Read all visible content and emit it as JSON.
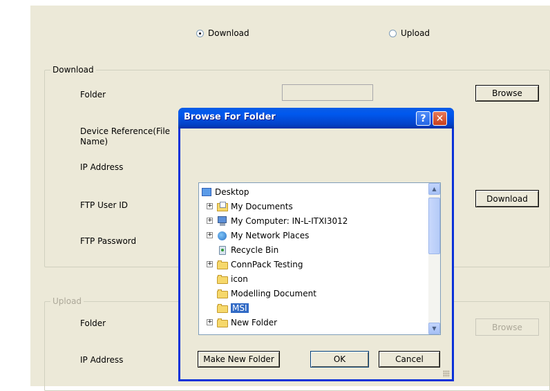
{
  "mode": {
    "download_label": "Download",
    "upload_label": "Upload",
    "selected": "Download"
  },
  "download_group": {
    "title": "Download",
    "folder_label": "Folder",
    "device_ref_label": "Device Reference(File Name)",
    "ip_label": "IP Address",
    "ftp_user_label": "FTP User ID",
    "ftp_password_label": "FTP Password",
    "browse_button": "Browse",
    "download_button": "Download",
    "folder_value": ""
  },
  "upload_group": {
    "title": "Upload",
    "folder_label": "Folder",
    "ip_label": "IP Address",
    "browse_button": "Browse"
  },
  "dialog": {
    "title": "Browse For Folder",
    "help_symbol": "?",
    "close_symbol": "✕",
    "tree": [
      {
        "label": "Desktop",
        "icon": "desktop-icon",
        "expander": "",
        "level": 0
      },
      {
        "label": "My Documents",
        "icon": "documents-icon",
        "expander": "+",
        "level": 1
      },
      {
        "label": "My Computer: IN-L-ITXI3012",
        "icon": "computer-icon",
        "expander": "+",
        "level": 1
      },
      {
        "label": "My Network Places",
        "icon": "network-icon",
        "expander": "+",
        "level": 1
      },
      {
        "label": "Recycle Bin",
        "icon": "recycle-bin-icon",
        "expander": "",
        "level": 1
      },
      {
        "label": "ConnPack Testing",
        "icon": "folder-icon",
        "expander": "+",
        "level": 1
      },
      {
        "label": "icon",
        "icon": "folder-icon",
        "expander": "",
        "level": 1
      },
      {
        "label": "Modelling Document",
        "icon": "folder-icon",
        "expander": "",
        "level": 1
      },
      {
        "label": "MSI",
        "icon": "folder-icon",
        "expander": "",
        "level": 1,
        "selected": true
      },
      {
        "label": "New Folder",
        "icon": "folder-icon",
        "expander": "+",
        "level": 1
      }
    ],
    "make_new_folder_button": "Make New Folder",
    "ok_button": "OK",
    "cancel_button": "Cancel"
  }
}
